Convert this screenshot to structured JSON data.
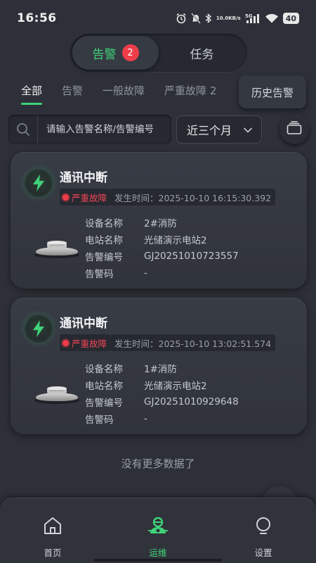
{
  "status_bar": {
    "time": "16:56",
    "net_speed_top": "10.0",
    "net_speed_bottom": "KB/s",
    "signal": "5G",
    "battery": "40"
  },
  "header_tabs": [
    {
      "label": "告警",
      "badge": "2",
      "active": true
    },
    {
      "label": "任务",
      "active": false
    }
  ],
  "filters": [
    {
      "label": "全部",
      "active": true
    },
    {
      "label": "告警",
      "active": false
    },
    {
      "label": "一般故障",
      "active": false
    },
    {
      "label": "严重故障 2",
      "active": false
    }
  ],
  "history_button": "历史告警",
  "search": {
    "placeholder": "请输入告警名称/告警编号"
  },
  "time_range": {
    "selected": "近三个月"
  },
  "labels": {
    "device_name": "设备名称",
    "station_name": "电站名称",
    "alarm_no": "告警编号",
    "alarm_code": "告警码"
  },
  "alarms": [
    {
      "title": "通讯中断",
      "severity": "严重故障",
      "time": "发生时间：2025-10-10 16:15:30.392",
      "device": "2#消防",
      "station": "光储演示电站2",
      "number": "GJ20251010723557",
      "code": "-"
    },
    {
      "title": "通讯中断",
      "severity": "严重故障",
      "time": "发生时间：2025-10-10 13:02:51.574",
      "device": "1#消防",
      "station": "光储演示电站2",
      "number": "GJ20251010929648",
      "code": "-"
    }
  ],
  "no_more": "没有更多数据了",
  "bottom_nav": [
    {
      "label": "首页",
      "icon": "home-icon",
      "active": false
    },
    {
      "label": "运维",
      "icon": "maintenance-icon",
      "active": true
    },
    {
      "label": "设置",
      "icon": "settings-bulb-icon",
      "active": false
    }
  ],
  "colors": {
    "accent": "#3fd27a",
    "danger": "#ef3d4a",
    "background": "#2d3038"
  }
}
